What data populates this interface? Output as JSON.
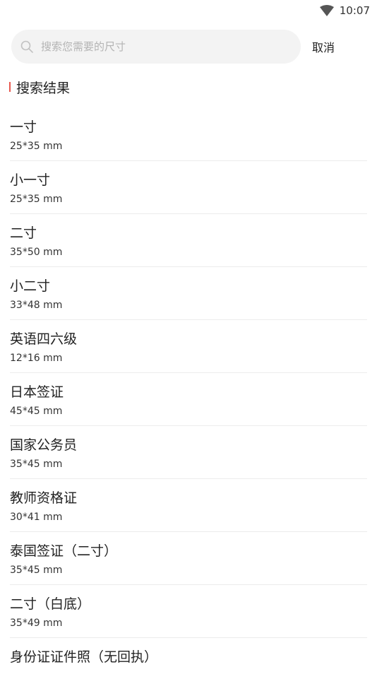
{
  "status_bar": {
    "time": "10:07",
    "wifi_icon": "wifi-icon"
  },
  "search": {
    "placeholder": "搜索您需要的尺寸",
    "value": "",
    "cancel_label": "取消",
    "icon": "search-icon"
  },
  "section": {
    "title": "搜索结果",
    "accent_color": "#e8584f"
  },
  "results": [
    {
      "name": "一寸",
      "size": "25*35 mm"
    },
    {
      "name": "小一寸",
      "size": "25*35 mm"
    },
    {
      "name": "二寸",
      "size": "35*50 mm"
    },
    {
      "name": "小二寸",
      "size": "33*48 mm"
    },
    {
      "name": "英语四六级",
      "size": "12*16 mm"
    },
    {
      "name": "日本签证",
      "size": "45*45 mm"
    },
    {
      "name": "国家公务员",
      "size": "35*45 mm"
    },
    {
      "name": "教师资格证",
      "size": "30*41 mm"
    },
    {
      "name": "泰国签证（二寸）",
      "size": "35*45 mm"
    },
    {
      "name": "二寸（白底）",
      "size": "35*49 mm"
    },
    {
      "name": "身份证证件照（无回执）",
      "size": ""
    }
  ]
}
